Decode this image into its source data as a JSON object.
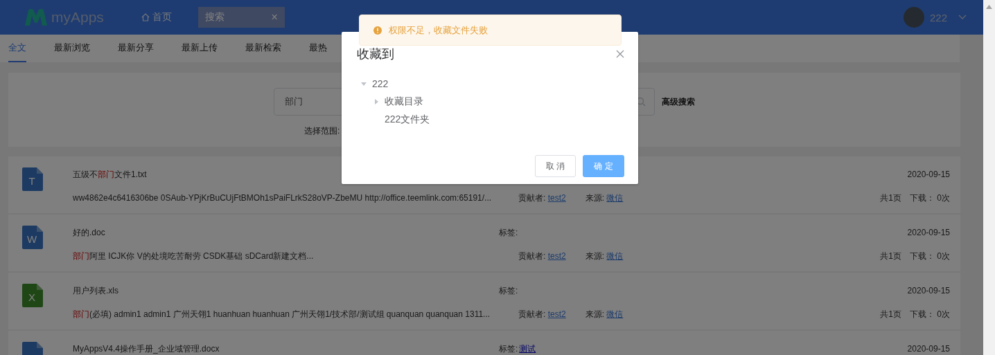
{
  "header": {
    "logo_text": "myApps",
    "home_label": "首页",
    "open_tab": {
      "label": "搜索",
      "close": "×"
    },
    "user": {
      "name": "222"
    }
  },
  "tabs": [
    {
      "label": "全文",
      "selected": true
    },
    {
      "label": "最新浏览",
      "selected": false
    },
    {
      "label": "最新分享",
      "selected": false
    },
    {
      "label": "最新上传",
      "selected": false
    },
    {
      "label": "最新检索",
      "selected": false
    },
    {
      "label": "最热",
      "selected": false
    }
  ],
  "search": {
    "value": "部门",
    "advanced": "高级搜索",
    "scope_label": "选择范围:"
  },
  "results": [
    {
      "kind": "txt",
      "letter": "T",
      "title": [
        {
          "text": "五级不",
          "highlight": false
        },
        {
          "text": "部门",
          "highlight": true
        },
        {
          "text": "文件1.txt",
          "highlight": false
        }
      ],
      "date": "2020-09-15",
      "snippet": [
        {
          "text": "ww4862e4c6416306be 0SAub-YPjKrBuCUjFtBMOh1sPaiFLrkS28oVP-ZbeMU http://office.teemlink.com:65191/...",
          "highlight": false
        }
      ],
      "contributor_label": "贡献者:",
      "contributor": "test2",
      "source_label": "来源:",
      "source": "微信",
      "pages": "共1页",
      "downloads_label": "下载：",
      "downloads": "0次"
    },
    {
      "kind": "doc",
      "letter": "W",
      "title": [
        {
          "text": "好的.doc",
          "highlight": false
        }
      ],
      "tag_label": "标签:",
      "date": "2020-09-15",
      "snippet": [
        {
          "text": "部门",
          "highlight": true
        },
        {
          "text": "阿里 ICJK你 V的处境吃苦耐劳 CSDK基础 sDCard新建文档...",
          "highlight": false
        }
      ],
      "contributor_label": "贡献者:",
      "contributor": "test2",
      "source_label": "来源:",
      "source": "微信",
      "pages": "共1页",
      "downloads_label": "下载：",
      "downloads": "0次"
    },
    {
      "kind": "xls",
      "letter": "X",
      "title": [
        {
          "text": "用户列表.xls",
          "highlight": false
        }
      ],
      "tag_label": "标签:",
      "date": "2020-09-15",
      "snippet": [
        {
          "text": "部门",
          "highlight": true
        },
        {
          "text": "(必填) admin1 admin1 广州天翎1 huanhuan huanhuan 广州天翎1/技术部/测试组 quanquan quanquan 1311...",
          "highlight": false
        }
      ],
      "contributor_label": "贡献者:",
      "contributor": "test2",
      "source_label": "来源:",
      "source": "微信",
      "pages": "共1页",
      "downloads_label": "下载：",
      "downloads": "0次"
    },
    {
      "kind": "doc",
      "title": [
        {
          "text": "MyAppsV4.4操作手册_企业域管理.docx",
          "highlight": false
        }
      ],
      "tag_label": "标签:",
      "tag": "测试",
      "date": "2020-09-15"
    }
  ],
  "dialog": {
    "title": "收藏到",
    "tree": [
      {
        "label": "222",
        "expanded": true,
        "children": [
          {
            "label": "收藏目录",
            "expanded": false,
            "has_children": true
          },
          {
            "label": "222文件夹",
            "has_children": false
          }
        ]
      }
    ],
    "buttons": [
      {
        "label": "取 消",
        "kind": "default"
      },
      {
        "label": "确 定",
        "kind": "primary"
      }
    ]
  },
  "toast": {
    "message": "权限不足，收藏文件失败"
  }
}
